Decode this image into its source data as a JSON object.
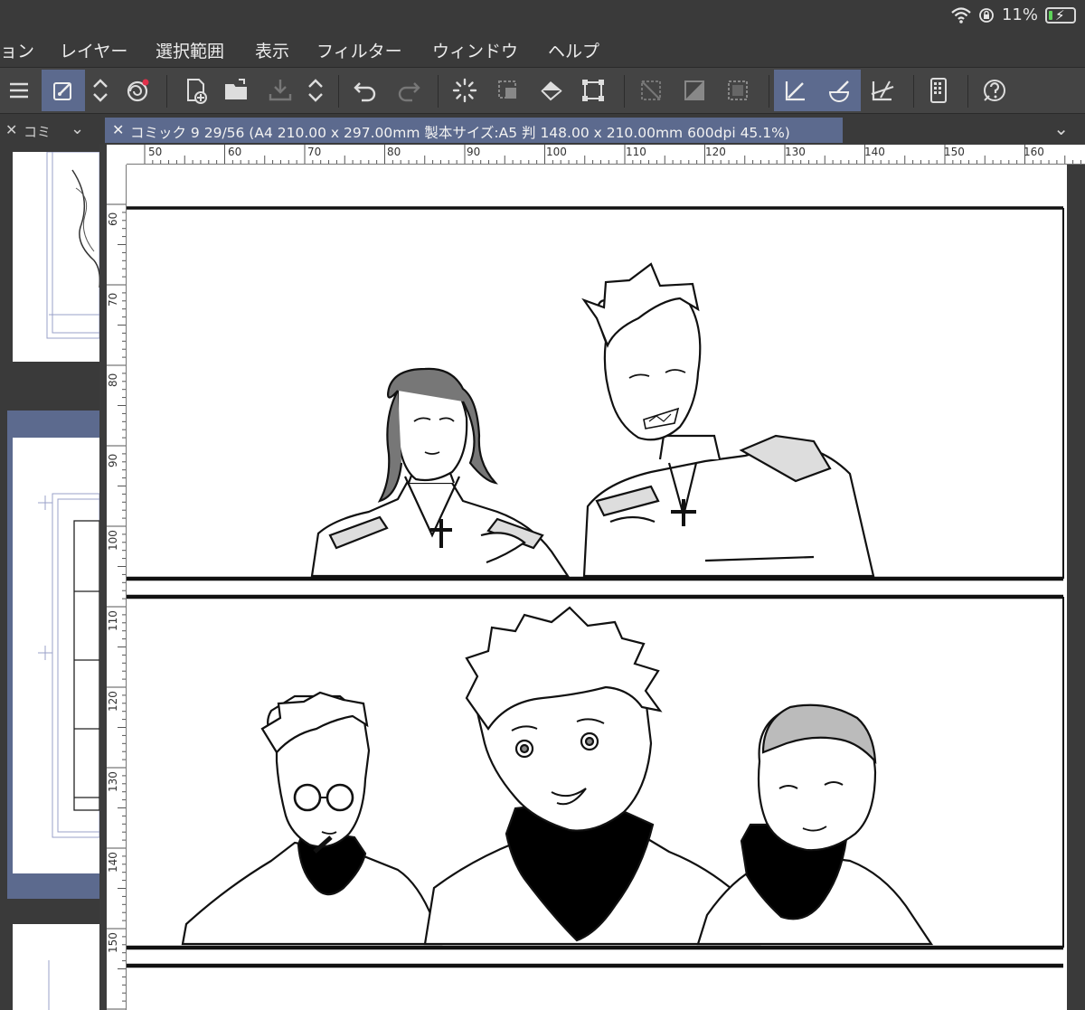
{
  "status": {
    "battery_text": "11%"
  },
  "menu": {
    "items": [
      "ョン",
      "レイヤー",
      "選択範囲",
      "表示",
      "フィルター",
      "ウィンドウ",
      "ヘルプ"
    ]
  },
  "left_panel": {
    "tab_label": "コミ"
  },
  "document": {
    "tab_title": "コミック 9 29/56 (A4 210.00 x 297.00mm 製本サイズ:A5 判 148.00 x 210.00mm 600dpi 45.1%)"
  },
  "rulers": {
    "horizontal": [
      "50",
      "60",
      "70",
      "80",
      "90",
      "100",
      "110",
      "120",
      "130",
      "140",
      "150",
      "160"
    ],
    "vertical": [
      "60",
      "70",
      "80",
      "90",
      "100",
      "110",
      "120",
      "130",
      "140",
      "150"
    ]
  },
  "colors": {
    "accent": "#5c6a8e",
    "chrome": "#3a3a3a",
    "toolbar": "#444444"
  },
  "toolbar_icons": [
    "hamburger-menu-icon",
    "pen-tool-icon",
    "swap-arrows-icon",
    "spiral-tool-icon",
    "new-page-icon",
    "open-folder-icon",
    "import-icon",
    "expand-arrows-icon",
    "undo-icon",
    "redo-icon",
    "lasso-loading-icon",
    "select-marquee-icon",
    "fill-bucket-icon",
    "transform-icon",
    "clear-selection-icon",
    "fill-gray-icon",
    "select-dashed-icon",
    "ruler-snap-icon",
    "brush-snap-icon",
    "ruler-perspective-icon",
    "device-icon",
    "help-icon"
  ]
}
